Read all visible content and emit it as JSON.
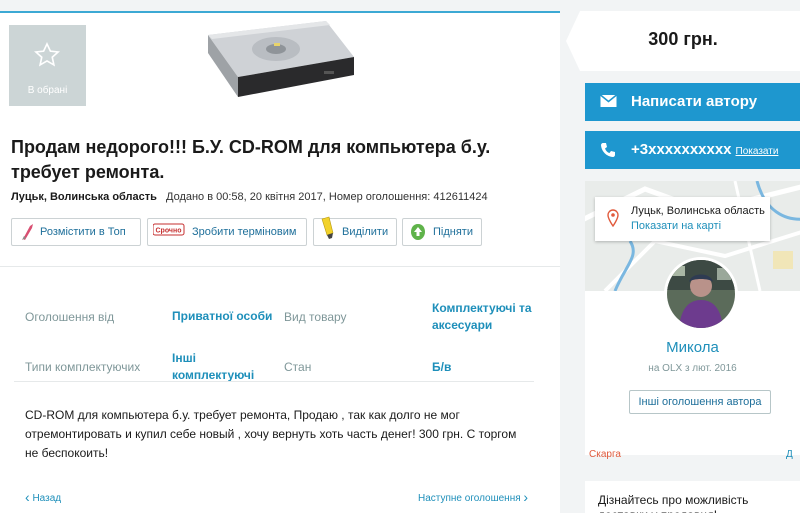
{
  "favorite": {
    "label": "В обрані",
    "icon": "star-icon"
  },
  "ad": {
    "title": "Продам недорого!!! Б.У. CD-ROM для компьютера б.у. требует ремонта.",
    "city": "Луцьк, Волинська область",
    "meta": "Додано в 00:58, 20 квітня 2017, Номер оголошення: 412611424",
    "description": "CD-ROM для компьютера б.у. требует ремонта, Продаю , так как долго не мог отремонтировать и купил себе новый , хочу вернуть хоть часть денег! 300 грн. С торгом не беспокоить!"
  },
  "actions": [
    {
      "label": "Розмістити в Топ",
      "icon": "rocket-icon"
    },
    {
      "label": "Зробити терміновим",
      "icon": "urgent-tag-icon",
      "badge": "Срочно"
    },
    {
      "label": "Виділити",
      "icon": "highlighter-icon"
    },
    {
      "label": "Підняти",
      "icon": "up-arrow-icon"
    }
  ],
  "details": {
    "offer_from_label": "Оголошення від",
    "offer_from_value": "Приватної особи",
    "product_type_label": "Вид товару",
    "product_type_value": "Комплектуючі та аксесуари",
    "component_type_label": "Типи комплектуючих",
    "component_type_value": "Інші комплектуючі",
    "condition_label": "Стан",
    "condition_value": "Б/в"
  },
  "nav": {
    "back": "Назад",
    "next": "Наступне оголошення"
  },
  "price": "300 грн.",
  "contact": {
    "write_label": "Написати автору",
    "phone": "+3xxxxxxxxxx",
    "show_label": "Показати"
  },
  "user": {
    "location": "Луцьк, Волинська область",
    "map_link": "Показати на карті",
    "name": "Микола",
    "since": "на OLX з лют. 2016",
    "other_ads": "Інші оголошення автора"
  },
  "complain": "Скарга",
  "complain2": "Д",
  "promo": "Дізнайтесь про можливість доставки у продавця!",
  "colors": {
    "accent": "#1e97cf",
    "link": "#1e8fba",
    "danger": "#e15a3c"
  }
}
